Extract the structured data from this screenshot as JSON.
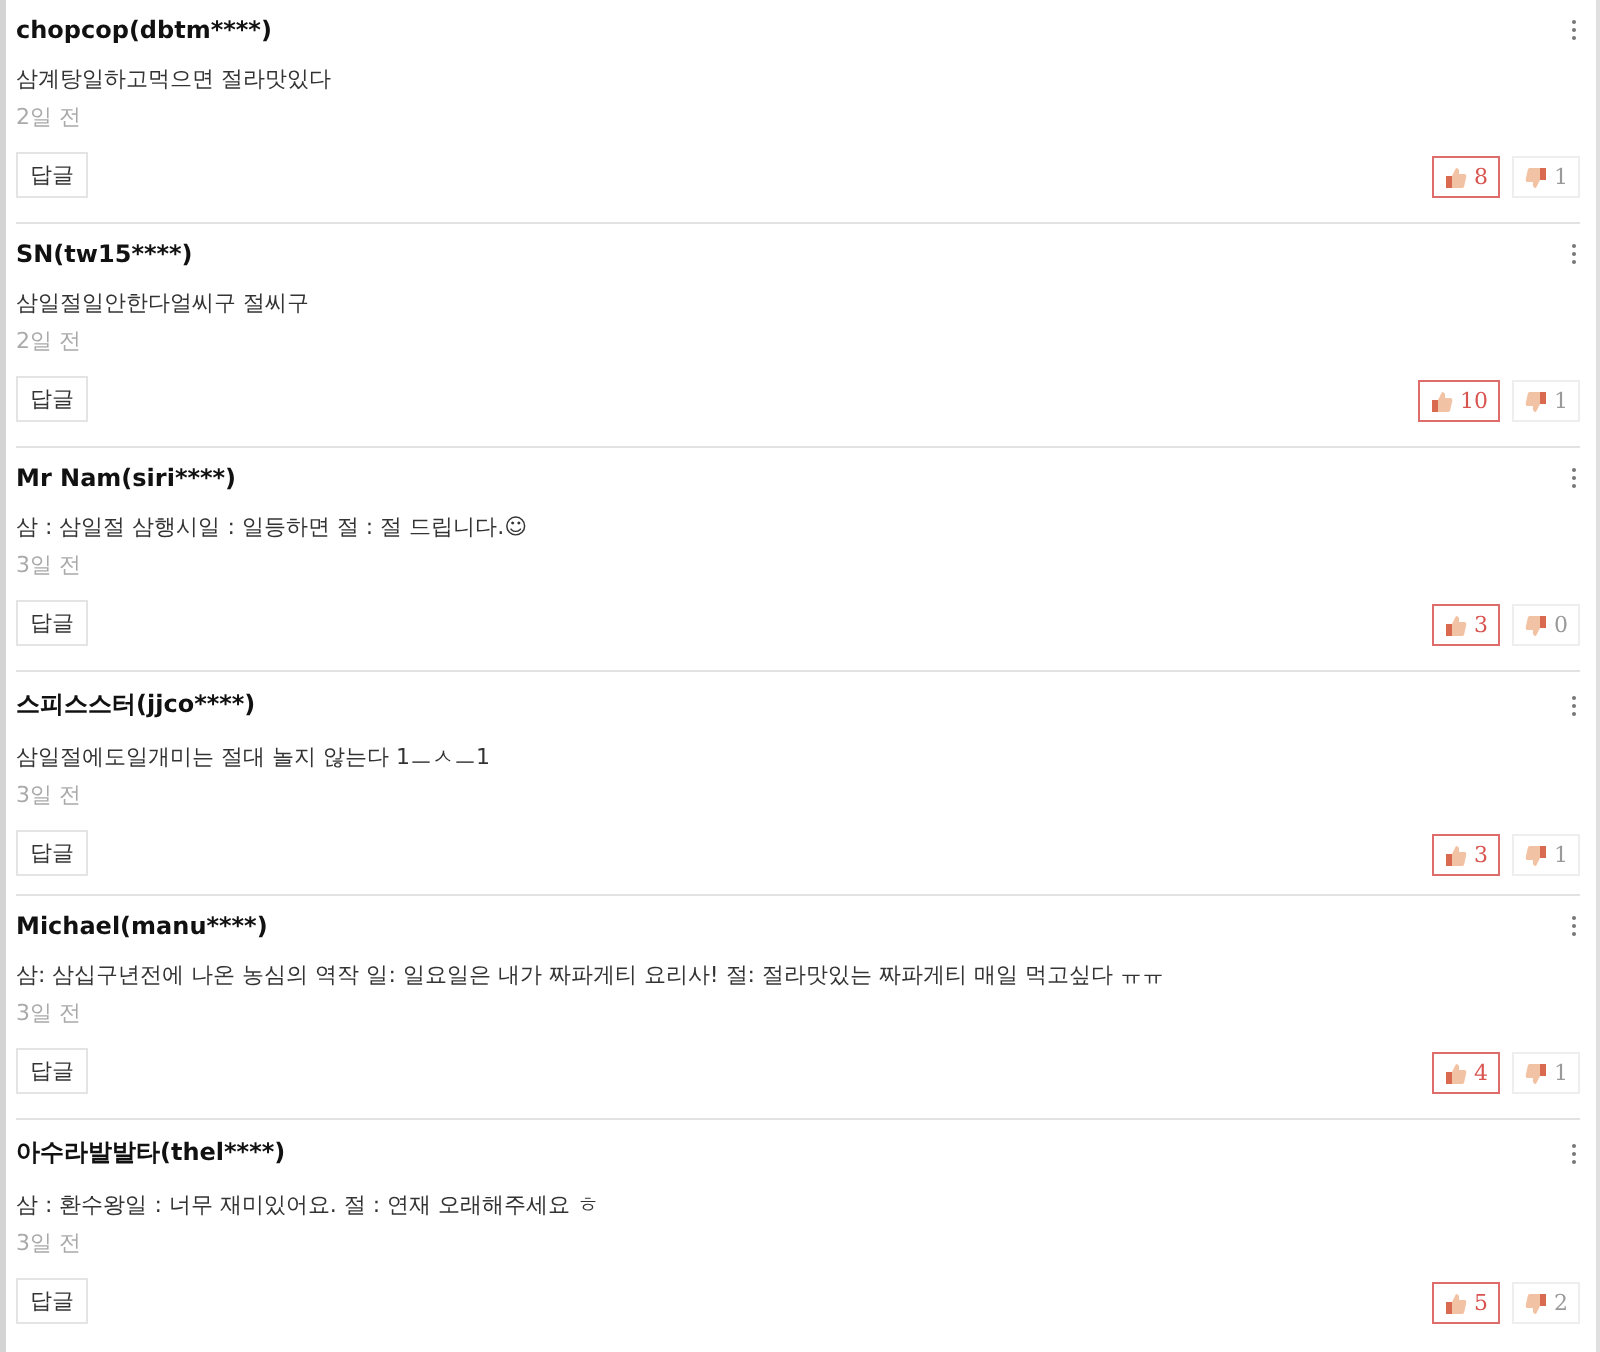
{
  "comments": [
    {
      "author": "chopcop(dbtm****)",
      "text": "삼계탕일하고먹으면 절라맛있다",
      "time": "2일 전",
      "reply": "답글",
      "likes": "8",
      "dislikes": "1"
    },
    {
      "author": "SN(tw15****)",
      "text": "삼일절일안한다얼씨구 절씨구",
      "time": "2일 전",
      "reply": "답글",
      "likes": "10",
      "dislikes": "1"
    },
    {
      "author": "Mr Nam(siri****)",
      "text": "삼 : 삼일절 삼행시일 : 일등하면 절 : 절 드립니다.☺",
      "time": "3일 전",
      "reply": "답글",
      "likes": "3",
      "dislikes": "0"
    },
    {
      "author": "스피스스터(jjco****)",
      "text": "삼일절에도일개미는 절대 놀지 않는다 1ㅡㅅㅡ1",
      "time": "3일 전",
      "reply": "답글",
      "likes": "3",
      "dislikes": "1"
    },
    {
      "author": "Michael(manu****)",
      "text": "삼: 삼십구년전에 나온 농심의 역작 일: 일요일은 내가 짜파게티 요리사! 절: 절라맛있는 짜파게티 매일 먹고싶다 ㅠㅠ",
      "time": "3일 전",
      "reply": "답글",
      "likes": "4",
      "dislikes": "1"
    },
    {
      "author": "아수라발발타(thel****)",
      "text": "삼 : 환수왕일 : 너무 재미있어요. 절 : 연재 오래해주세요 ㅎ",
      "time": "3일 전",
      "reply": "답글",
      "likes": "5",
      "dislikes": "2"
    }
  ]
}
